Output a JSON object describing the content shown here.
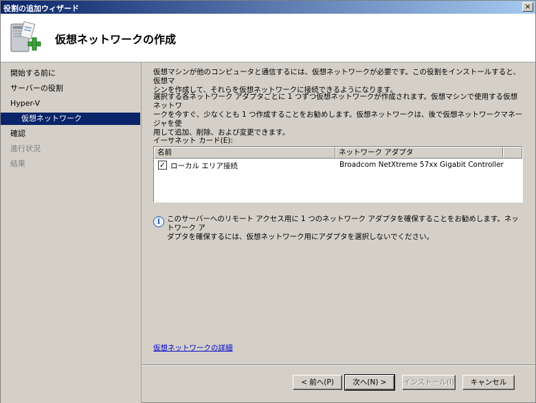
{
  "window": {
    "title": "役割の追加ウィザード",
    "close_glyph": "×"
  },
  "header": {
    "title": "仮想ネットワークの作成",
    "icon": "server-add-icon"
  },
  "nav": {
    "items": [
      {
        "label": "開始する前に",
        "state": "normal"
      },
      {
        "label": "サーバーの役割",
        "state": "normal"
      },
      {
        "label": "Hyper-V",
        "state": "normal"
      },
      {
        "label": "仮想ネットワーク",
        "state": "selected"
      },
      {
        "label": "確認",
        "state": "normal"
      },
      {
        "label": "進行状況",
        "state": "disabled"
      },
      {
        "label": "結果",
        "state": "disabled"
      }
    ]
  },
  "content": {
    "para1": "仮想マシンが他のコンピュータと通信するには、仮想ネットワークが必要です。この役割をインストールすると、仮想マ\nシンを作成して、それらを仮想ネットワークに接続できるようになります。",
    "para2": "選択する各ネットワーク アダプタごとに 1 つずつ仮想ネットワークが作成されます。仮想マシンで使用する仮想ネットワ\nークを今すぐ、少なくとも 1 つ作成することをお勧めします。仮想ネットワークは、後で仮想ネットワークマネージャを使\n用して追加、削除、および変更できます。",
    "ethernet_label": "イーサネット カード(E):",
    "table": {
      "columns": [
        "名前",
        "ネットワーク アダプタ"
      ],
      "rows": [
        {
          "checked": true,
          "check_glyph": "✓",
          "name": "ローカル エリア接続",
          "adapter": "Broadcom NetXtreme 57xx Gigabit Controller"
        }
      ]
    },
    "info_glyph": "i",
    "info_text": "このサーバーへのリモート アクセス用に 1 つのネットワーク アダプタを確保することをお勧めします。ネットワーク ア\nダプタを確保するには、仮想ネットワーク用にアダプタを選択しないでください。",
    "more_link": "仮想ネットワークの詳細"
  },
  "buttons": {
    "back": "< 前へ(P)",
    "next": "次へ(N) >",
    "install": "インストール(I)",
    "cancel": "キャンセル"
  },
  "colors": {
    "title_start": "#0a246a",
    "title_end": "#a6caf0",
    "selection": "#0a246a",
    "link": "#0000cc"
  }
}
